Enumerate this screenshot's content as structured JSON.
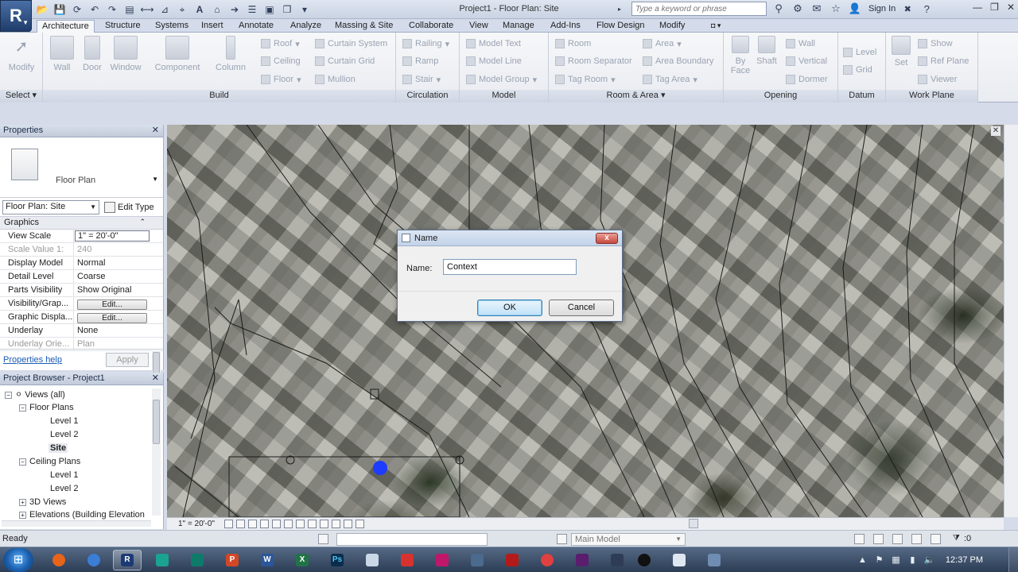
{
  "app": {
    "title": "Project1 - Floor Plan: Site",
    "logo_letter": "R"
  },
  "search": {
    "placeholder": "Type a keyword or phrase",
    "signin_label": "Sign In"
  },
  "ribbon": {
    "tabs": [
      "Architecture",
      "Structure",
      "Systems",
      "Insert",
      "Annotate",
      "Analyze",
      "Massing & Site",
      "Collaborate",
      "View",
      "Manage",
      "Add-Ins",
      "Flow Design",
      "Modify"
    ],
    "active_tab": "Architecture",
    "groups": [
      "Select ▾",
      "Build",
      "Circulation",
      "Model",
      "Room & Area ▾",
      "Opening",
      "Datum",
      "Work Plane"
    ],
    "build_buttons": [
      "Modify",
      "Wall",
      "Door",
      "Window",
      "Component",
      "Column"
    ],
    "build_small": [
      "Roof",
      "Ceiling",
      "Floor",
      "Curtain System",
      "Curtain Grid",
      "Mullion"
    ],
    "circulation_small": [
      "Railing",
      "Ramp",
      "Stair"
    ],
    "model_small": [
      "Model Text",
      "Model Line",
      "Model Group"
    ],
    "room_small": [
      "Room",
      "Room Separator",
      "Tag Room",
      "Area",
      "Area Boundary",
      "Tag Area"
    ],
    "opening_items": [
      "By Face",
      "Shaft",
      "Wall",
      "Vertical",
      "Dormer"
    ],
    "datum_small": [
      "Level",
      "Grid"
    ],
    "workplane_items": [
      "Set",
      "Show",
      "Ref Plane",
      "Viewer"
    ]
  },
  "properties": {
    "title": "Properties",
    "type_name": "Floor Plan",
    "instance": "Floor Plan: Site",
    "edit_type": "Edit Type",
    "section": "Graphics",
    "rows": [
      {
        "key": "View Scale",
        "value": "1\" = 20'-0\""
      },
      {
        "key": "Scale Value    1:",
        "value": "240"
      },
      {
        "key": "Display Model",
        "value": "Normal"
      },
      {
        "key": "Detail Level",
        "value": "Coarse"
      },
      {
        "key": "Parts Visibility",
        "value": "Show Original"
      },
      {
        "key": "Visibility/Grap...",
        "value": "Edit..."
      },
      {
        "key": "Graphic Displa...",
        "value": "Edit..."
      },
      {
        "key": "Underlay",
        "value": "None"
      },
      {
        "key": "Underlay Orie...",
        "value": "Plan"
      }
    ],
    "help_link": "Properties help",
    "apply_label": "Apply"
  },
  "browser": {
    "title": "Project Browser - Project1",
    "tree": [
      {
        "label": "Views (all)",
        "toggle": "−"
      },
      {
        "label": "Floor Plans",
        "toggle": "−"
      },
      {
        "label": "Level 1",
        "toggle": ""
      },
      {
        "label": "Level 2",
        "toggle": ""
      },
      {
        "label": "Site",
        "toggle": ""
      },
      {
        "label": "Ceiling Plans",
        "toggle": "−"
      },
      {
        "label": "Level 1",
        "toggle": ""
      },
      {
        "label": "Level 2",
        "toggle": ""
      },
      {
        "label": "3D Views",
        "toggle": "+"
      },
      {
        "label": "Elevations (Building Elevation",
        "toggle": "+"
      }
    ]
  },
  "canvas": {
    "scale_label": "1\" = 20'-0\""
  },
  "dialog": {
    "title": "Name",
    "close_label": "x",
    "name_label": "Name:",
    "name_value": "Context",
    "ok_label": "OK",
    "cancel_label": "Cancel"
  },
  "status": {
    "text": "Ready",
    "model": "Main Model",
    "model_count": ":0"
  },
  "taskbar": {
    "time": "12:37 PM",
    "apps": [
      "Firefox",
      "Chrome",
      "Revit",
      "Sketchbook",
      "Publisher",
      "PowerPoint",
      "Word",
      "Excel",
      "Photoshop",
      "Notepad",
      "PDF",
      "InDesign",
      "Explorer",
      "Acrobat",
      "Paint",
      "Blender",
      "Notes",
      "Remote"
    ]
  }
}
